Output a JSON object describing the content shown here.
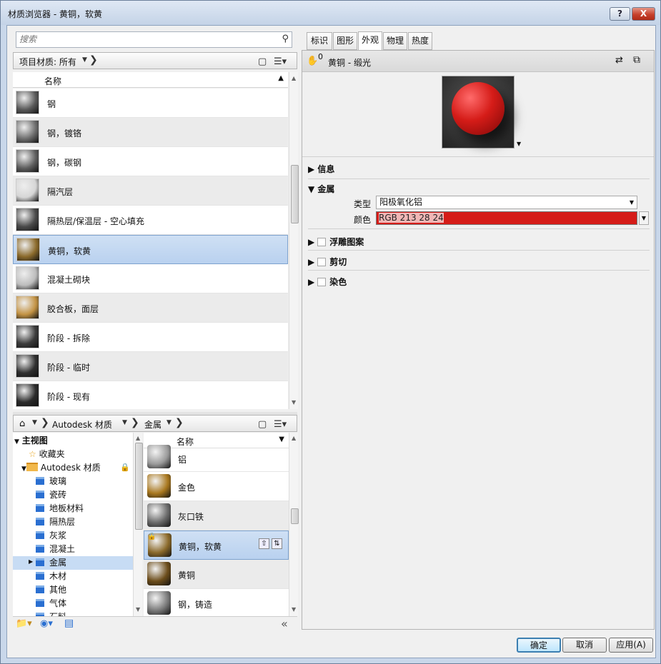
{
  "window": {
    "title": "材质浏览器 - 黄铜，软黄",
    "help": "?",
    "close": "X"
  },
  "search": {
    "placeholder": "搜索"
  },
  "project_filter": {
    "label": "项目材质: 所有"
  },
  "project_list": {
    "header": "名称",
    "items": [
      {
        "name": "钢",
        "color": "#5a5a5a"
      },
      {
        "name": "钢，镀铬",
        "color": "#6d6d6d"
      },
      {
        "name": "钢，碳钢",
        "color": "#5f5f5f"
      },
      {
        "name": "隔汽层",
        "color": "#d6d6d6"
      },
      {
        "name": "隔热层/保温层 - 空心填充",
        "color": "#4a4a4a"
      },
      {
        "name": "黄铜，软黄",
        "color": "#8b6a2b"
      },
      {
        "name": "混凝土砌块",
        "color": "#bdbdbd"
      },
      {
        "name": "胶合板，面层",
        "color": "#c39345"
      },
      {
        "name": "阶段 - 拆除",
        "color": "#3b3b3b"
      },
      {
        "name": "阶段 - 临时",
        "color": "#303030"
      },
      {
        "name": "阶段 - 现有",
        "color": "#2b2b2b"
      }
    ],
    "selected": 5
  },
  "library_breadcrumb": {
    "root": "Autodesk 材质",
    "child": "金属"
  },
  "tree": {
    "home": "主视图",
    "favorites": "收藏夹",
    "library": "Autodesk 材质",
    "categories": [
      "玻璃",
      "瓷砖",
      "地板材料",
      "隔热层",
      "灰浆",
      "混凝土",
      "金属",
      "木材",
      "其他",
      "气体",
      "石料"
    ],
    "selected": "金属"
  },
  "library_list": {
    "header": "名称",
    "items": [
      {
        "name": "铝",
        "color": "#9a9a9a"
      },
      {
        "name": "金色",
        "color": "#a9781f"
      },
      {
        "name": "灰口铁",
        "color": "#6a6a6a"
      },
      {
        "name": "黄铜，软黄",
        "color": "#8b6a2b"
      },
      {
        "name": "黄铜",
        "color": "#6c4d1b"
      },
      {
        "name": "钢，铸造",
        "color": "#7a7a7a"
      }
    ]
  },
  "tabs": [
    "标识",
    "图形",
    "外观",
    "物理",
    "热度"
  ],
  "active_tab": "外观",
  "asset": {
    "users": "0",
    "name": "黄铜 - 缎光"
  },
  "sections": {
    "info": "信息",
    "metal": "金属",
    "emboss": "浮雕图案",
    "cutout": "剪切",
    "tint": "染色"
  },
  "properties": {
    "type_label": "类型",
    "type_value": "阳极氧化铝",
    "color_label": "颜色",
    "color_value": "RGB 213 28 24",
    "color_hex": "#d51c18"
  },
  "buttons": {
    "ok": "确定",
    "cancel": "取消",
    "apply": "应用(A)"
  }
}
